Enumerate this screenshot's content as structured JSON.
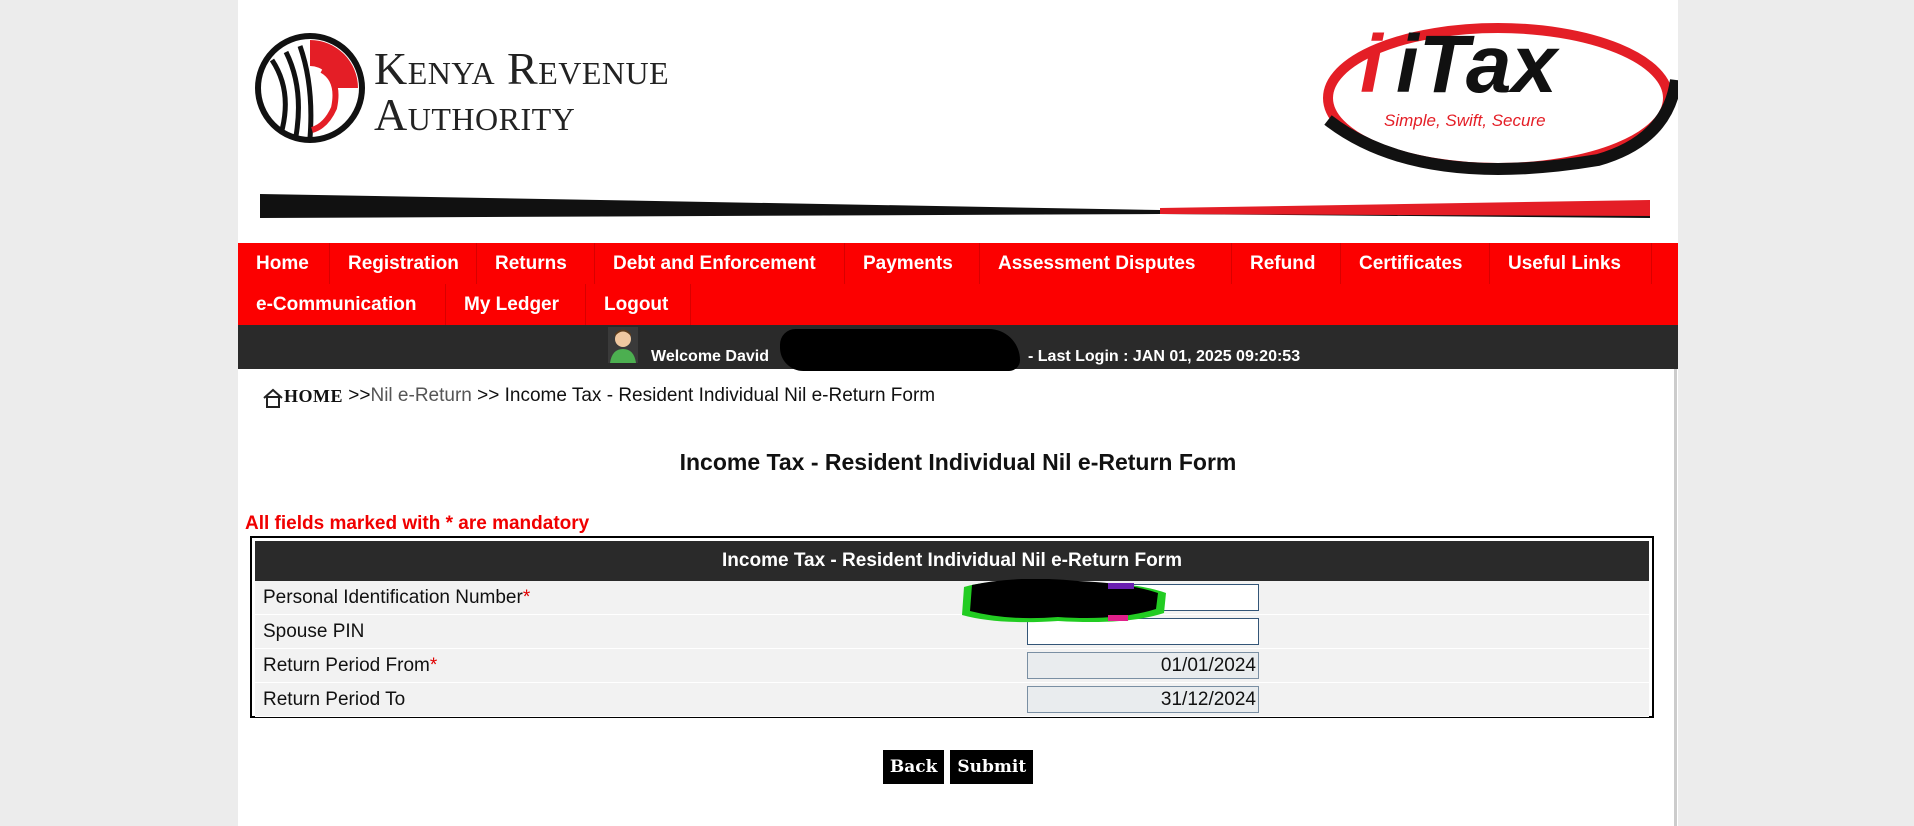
{
  "header": {
    "org_line1": "Kenya Revenue",
    "org_line2": "Authority",
    "itax_logo_text": "iTax",
    "itax_tagline": "Simple, Swift, Secure"
  },
  "nav": {
    "items": [
      {
        "label": "Home"
      },
      {
        "label": "Registration"
      },
      {
        "label": "Returns"
      },
      {
        "label": "Debt and Enforcement"
      },
      {
        "label": "Payments"
      },
      {
        "label": "Assessment Disputes"
      },
      {
        "label": "Refund"
      },
      {
        "label": "Certificates"
      },
      {
        "label": "Useful Links"
      },
      {
        "label": "e-Communication"
      },
      {
        "label": "My Ledger"
      },
      {
        "label": "Logout"
      }
    ]
  },
  "welcome": {
    "text": "Welcome David",
    "last_login": "- Last Login : JAN 01, 2025 09:20:53"
  },
  "breadcrumb": {
    "home": "HOME",
    "sep1": ">>",
    "nil_return": "Nil e-Return",
    "sep2": ">>",
    "current": "Income Tax - Resident Individual Nil e-Return Form"
  },
  "page_title": "Income Tax - Resident Individual Nil e-Return Form",
  "mandatory_note": "All fields marked with * are mandatory",
  "form": {
    "header": "Income Tax - Resident Individual Nil e-Return Form",
    "rows": [
      {
        "label": "Personal Identification Number",
        "required": "*",
        "value": ""
      },
      {
        "label": "Spouse PIN",
        "required": "",
        "value": ""
      },
      {
        "label": "Return Period From",
        "required": "*",
        "value": "01/01/2024"
      },
      {
        "label": "Return Period To",
        "required": "",
        "value": "31/12/2024"
      }
    ]
  },
  "buttons": {
    "back": "Back",
    "submit": "Submit"
  },
  "colors": {
    "brand_red": "#fc0000",
    "bar_dark": "#2a2a2a"
  }
}
